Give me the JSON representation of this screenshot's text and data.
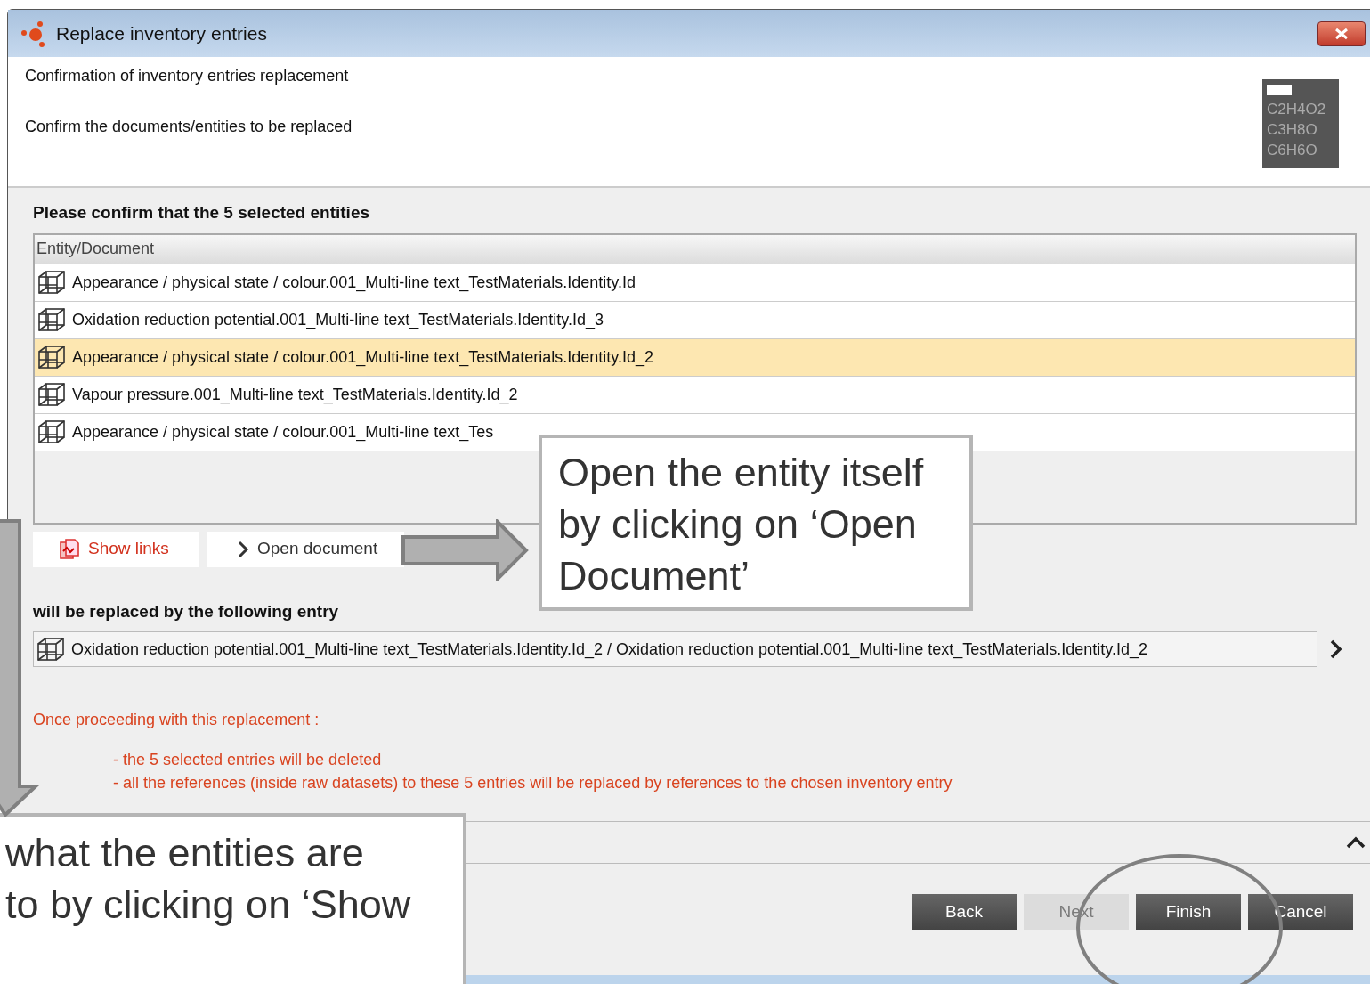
{
  "window": {
    "title": "Replace inventory entries"
  },
  "header": {
    "title": "Confirmation of inventory entries replacement",
    "subtitle": "Confirm the documents/entities to be replaced",
    "logo_lines": [
      "C2H4O2",
      "C3H8O",
      "C6H6O"
    ]
  },
  "selection": {
    "heading": "Please confirm that the 5 selected entities",
    "column": "Entity/Document",
    "rows": [
      {
        "text": "Appearance / physical state / colour.001_Multi-line text_TestMaterials.Identity.Id",
        "selected": false
      },
      {
        "text": "Oxidation reduction potential.001_Multi-line text_TestMaterials.Identity.Id_3",
        "selected": false
      },
      {
        "text": "Appearance / physical state / colour.001_Multi-line text_TestMaterials.Identity.Id_2",
        "selected": true
      },
      {
        "text": "Vapour pressure.001_Multi-line text_TestMaterials.Identity.Id_2",
        "selected": false
      },
      {
        "text": "Appearance / physical state / colour.001_Multi-line text_Tes",
        "selected": false
      }
    ]
  },
  "actions": [
    {
      "kind": "links",
      "label": "Show links"
    },
    {
      "kind": "open",
      "label": "Open document"
    }
  ],
  "replacement": {
    "heading": "will be replaced by the following entry",
    "value": "Oxidation reduction potential.001_Multi-line text_TestMaterials.Identity.Id_2 / Oxidation reduction potential.001_Multi-line text_TestMaterials.Identity.Id_2"
  },
  "warning": {
    "title": "Once proceeding with this replacement :",
    "items": [
      "- the 5 selected entries will be deleted",
      "- all the references (inside raw datasets) to these 5 entries will be replaced by references to the chosen inventory entry"
    ]
  },
  "buttons": [
    {
      "label": "Back",
      "disabled": false
    },
    {
      "label": "Next",
      "disabled": true
    },
    {
      "label": "Finish",
      "disabled": false
    },
    {
      "label": "Cancel",
      "disabled": false
    }
  ],
  "callouts": [
    {
      "kind": "right",
      "lines": [
        "Open the entity itself",
        "by clicking on ‘Open",
        "Document’"
      ]
    },
    {
      "kind": "left",
      "lines": [
        "what the entities are",
        "to by clicking on ‘Show"
      ]
    }
  ]
}
